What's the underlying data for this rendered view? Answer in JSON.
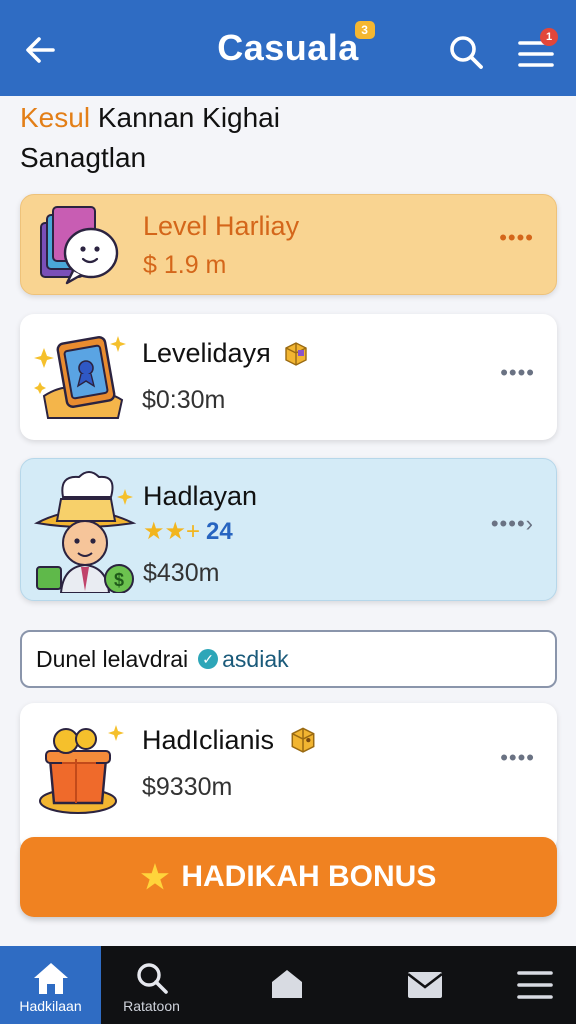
{
  "header": {
    "title": "Casuala",
    "title_badge": "3",
    "menu_badge": "1",
    "icons": {
      "back": "arrow-left-icon",
      "search": "search-icon",
      "menu": "hamburger-menu-icon"
    }
  },
  "intro": {
    "accent": "Kesul",
    "line1_rest": " Kannan Kighai",
    "line2": "Sanagtlan"
  },
  "cards": [
    {
      "name": "Level Harliay",
      "price": "$ 1.9 m",
      "illustration": "chat-books-icon",
      "more": "••••"
    },
    {
      "name": "Levelidayя",
      "price": "$0:30m",
      "illustration": "tablet-award-icon",
      "badge_icon": "gift-box-icon",
      "more": "••••"
    },
    {
      "name": "Hadlayan",
      "stars": "★★+",
      "rating": "24",
      "price": "$430m",
      "illustration": "chef-money-icon",
      "more": "••••›"
    },
    {
      "name": "HadIclianis",
      "price": "$9330m",
      "illustration": "treasure-pot-icon",
      "badge_icon": "gift-box-icon",
      "more": "••••"
    }
  ],
  "info_bar": {
    "text": "Dunel lelavdrai",
    "verified_text": "asdiak",
    "icon": "check-badge-icon"
  },
  "bonus_button": {
    "label": "HADIKAH BONUS",
    "icon": "star-icon"
  },
  "bottom_nav": [
    {
      "label": "Hadkilaan",
      "icon": "home-icon",
      "active": true
    },
    {
      "label": "Ratatoon",
      "icon": "search-icon"
    },
    {
      "label": "",
      "icon": "house-icon"
    },
    {
      "label": "",
      "icon": "mail-icon"
    },
    {
      "label": "",
      "icon": "hamburger-menu-icon"
    }
  ],
  "colors": {
    "header": "#2f6cc3",
    "accent_orange": "#f08221",
    "card_gold": "#f9d491",
    "card_blue": "#d4ebf7",
    "nav_bg": "#101113"
  }
}
